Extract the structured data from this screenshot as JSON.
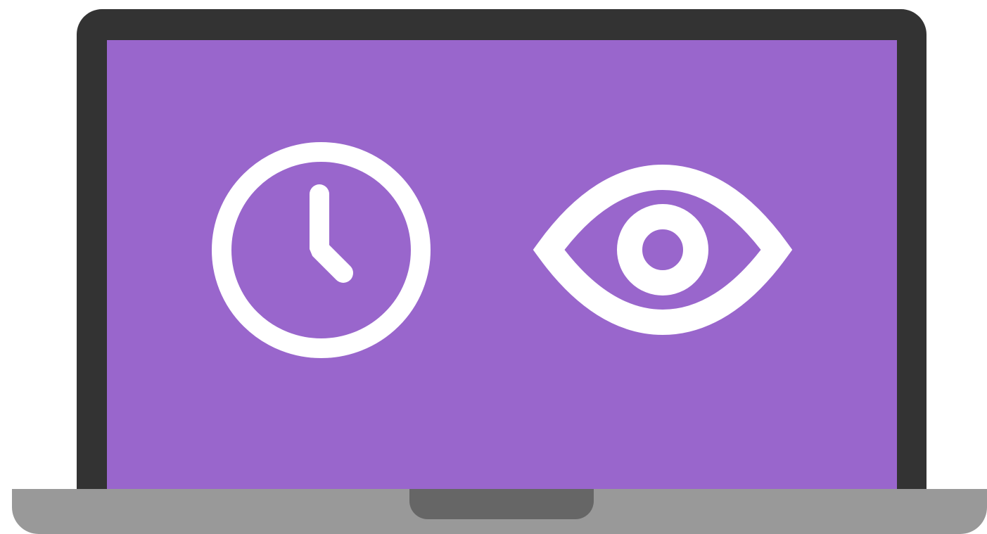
{
  "scene": {
    "description_icons": [
      "clock-icon",
      "eye-icon"
    ],
    "colors": {
      "screen": "#9966cc",
      "bezel": "#333333",
      "base": "#999999",
      "notch": "#666666",
      "icon": "#ffffff"
    }
  }
}
